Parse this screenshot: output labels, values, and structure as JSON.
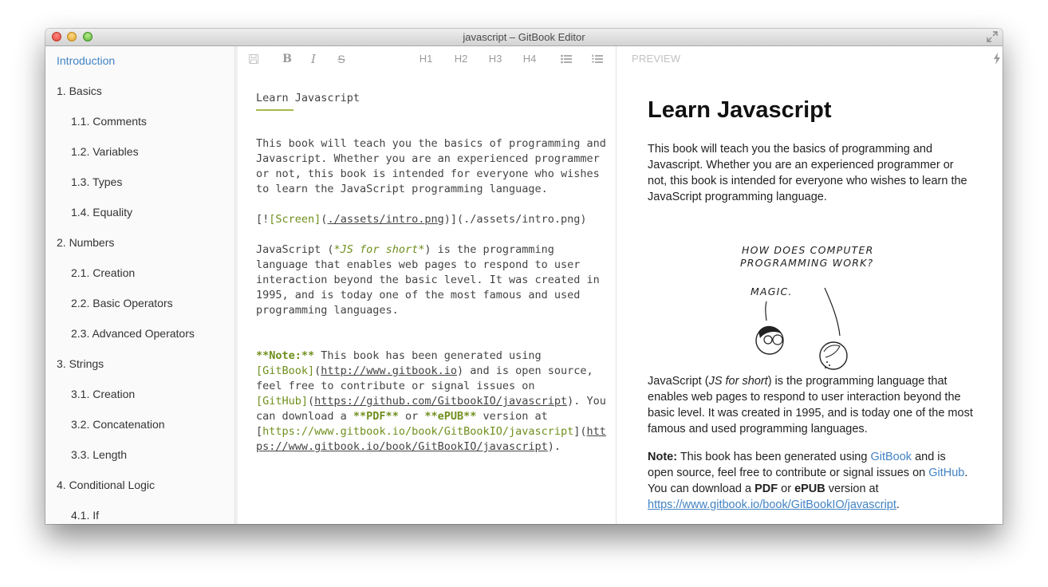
{
  "window": {
    "title": "javascript – GitBook Editor"
  },
  "sidebar": {
    "items": [
      {
        "label": "Introduction",
        "active": true
      },
      {
        "label": "1. Basics"
      },
      {
        "label": "1.1. Comments"
      },
      {
        "label": "1.2. Variables"
      },
      {
        "label": "1.3. Types"
      },
      {
        "label": "1.4. Equality"
      },
      {
        "label": "2. Numbers"
      },
      {
        "label": "2.1. Creation"
      },
      {
        "label": "2.2. Basic Operators"
      },
      {
        "label": "2.3. Advanced Operators"
      },
      {
        "label": "3. Strings"
      },
      {
        "label": "3.1. Creation"
      },
      {
        "label": "3.2. Concatenation"
      },
      {
        "label": "3.3. Length"
      },
      {
        "label": "4. Conditional Logic"
      },
      {
        "label": "4.1. If"
      }
    ]
  },
  "toolbar": {
    "bold": "B",
    "italic": "I",
    "strike": "S",
    "h1": "H1",
    "h2": "H2",
    "h3": "H3",
    "h4": "H4",
    "icons": [
      "save-icon",
      "bullet-list-icon",
      "numbered-list-icon",
      "table-icon"
    ]
  },
  "editor": {
    "l1": "Learn Javascript",
    "l2": "This book will teach you the basics of programming and",
    "l3": "Javascript. Whether you are an experienced programmer",
    "l4": "or not, this book is intended for everyone who wishes",
    "l5": "to learn the JavaScript programming language.",
    "img_open": "[!",
    "img_alt": "[Screen]",
    "img_path_open": "(",
    "img_path": "./assets/intro.png",
    "img_close": ")](./assets/intro.png)",
    "js1a": "JavaScript (",
    "js1b": "*JS for short*",
    "js1c": ") is the programming",
    "js2": "language that enables web pages to respond to user",
    "js3": "interaction beyond the basic level. It was created in",
    "js4": "1995, and is today one of the most famous and used",
    "js5": "programming languages.",
    "n1a": "**Note:**",
    "n1b": " This book has been generated using",
    "n2a": "[GitBook]",
    "n2b": "(",
    "n2c": "http://www.gitbook.io",
    "n2d": ") and is open source,",
    "n3": "feel free to contribute or signal issues on",
    "n4a": "[GitHub]",
    "n4b": "(",
    "n4c": "https://github.com/GitbookIO/javascript",
    "n4d": "). You",
    "n5a": "can download a ",
    "n5b": "**PDF**",
    "n5c": " or ",
    "n5d": "**ePUB**",
    "n5e": " version at",
    "n6a": "[",
    "n6b": "https://www.gitbook.io/book/GitBookIO/javascript",
    "n6c": "](",
    "n6d": "htt",
    "n7a": "ps://www.gitbook.io/book/GitBookIO/javascript",
    "n7b": ")."
  },
  "preview": {
    "label": "PREVIEW",
    "title": "Learn Javascript",
    "p1": "This book will teach you the basics of programming and Javascript. Whether you are an experienced programmer or not, this book is intended for everyone who wishes to learn the JavaScript programming language.",
    "comic_q1": "HOW DOES COMPUTER",
    "comic_q2": "PROGRAMMING WORK?",
    "comic_a": "MAGIC.",
    "p2a": "JavaScript (",
    "p2b": "JS for short",
    "p2c": ") is the programming language that enables web pages to respond to user interaction beyond the basic level. It was created in 1995, and is today one of the most famous and used programming languages.",
    "p3a": "Note:",
    "p3b": " This book has been generated using ",
    "p3c": "GitBook",
    "p3d": " and is open source, feel free to contribute or signal issues on ",
    "p3e": "GitHub",
    "p3f": ". You can download a ",
    "p3g": "PDF",
    "p3h": " or ",
    "p3i": "ePUB",
    "p3j": " version at ",
    "p3k": "https://www.gitbook.io/book/GitBookIO/javascript",
    "p3l": ".",
    "icons": [
      "lightning-icon",
      "sync-icon"
    ],
    "accent": "#5cb85c"
  }
}
